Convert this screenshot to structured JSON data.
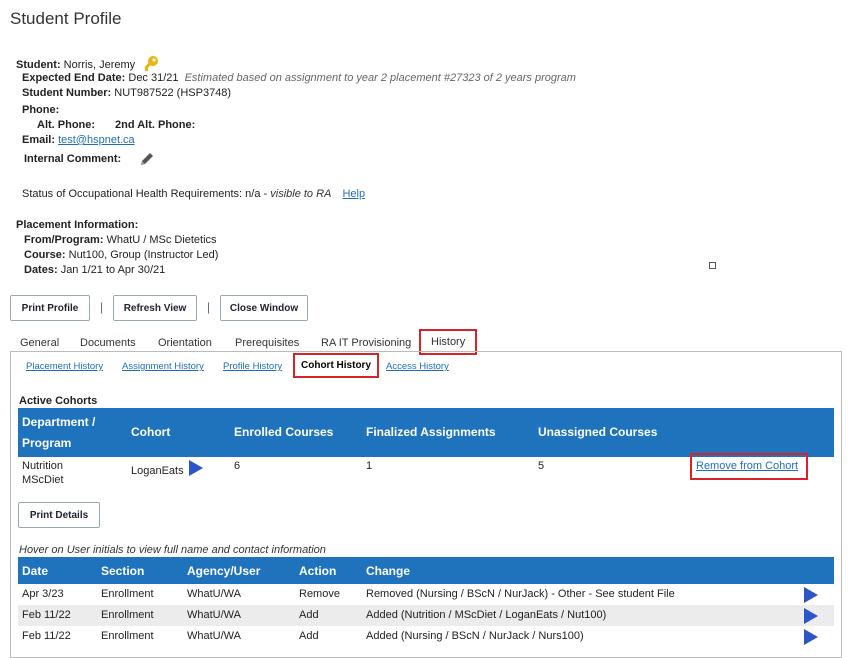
{
  "page_title": "Student Profile",
  "student": {
    "label": "Student:",
    "name": "Norris, Jeremy",
    "expected_end_label": "Expected End Date:",
    "expected_end": "Dec 31/21",
    "expected_end_note": "Estimated based on assignment to year 2 placement #27323 of 2 years program",
    "number_label": "Student Number:",
    "number": "NUT987522  (HSP3748)",
    "phone_label": "Phone:",
    "alt_phone_label": "Alt. Phone:",
    "alt2_phone_label": "2nd Alt. Phone:",
    "email_label": "Email:",
    "email": "test@hspnet.ca",
    "internal_comment_label": "Internal Comment:"
  },
  "health": {
    "text": "Status of Occupational Health Requirements: n/a -",
    "note": "visible to RA",
    "help": "Help"
  },
  "placement": {
    "heading": "Placement Information:",
    "from_label": "From/Program:",
    "from": "WhatU / MSc Dietetics",
    "course_label": "Course:",
    "course": "Nut100, Group (Instructor Led)",
    "dates_label": "Dates:",
    "dates": "Jan 1/21  to  Apr 30/21"
  },
  "buttons": {
    "print_profile": "Print Profile",
    "refresh_view": "Refresh View",
    "close_window": "Close Window",
    "sep": "|",
    "print_details": "Print Details"
  },
  "tabs": [
    "General",
    "Documents",
    "Orientation",
    "Prerequisites",
    "RA IT Provisioning",
    "History"
  ],
  "subtabs": [
    "Placement History",
    "Assignment History",
    "Profile History",
    "Cohort History",
    "Access History"
  ],
  "active_cohorts": {
    "heading": "Active Cohorts",
    "headers": [
      "Department /",
      "Program",
      "Cohort",
      "Enrolled Courses",
      "Finalized Assignments",
      "Unassigned Courses"
    ],
    "row": {
      "dept1": "Nutrition",
      "dept2": "MScDiet",
      "cohort": "LoganEats",
      "enrolled": "6",
      "finalized": "1",
      "unassigned": "5",
      "action": "Remove from Cohort"
    }
  },
  "history": {
    "hint": "Hover on User initials to view full name and contact information",
    "headers": [
      "Date",
      "Section",
      "Agency/User",
      "Action",
      "Change"
    ],
    "rows": [
      {
        "date": "Apr 3/23",
        "section": "Enrollment",
        "agency": "WhatU/WA",
        "action": "Remove",
        "change": "Removed (Nursing / BScN / NurJack) - Other - See student File"
      },
      {
        "date": "Feb 11/22",
        "section": "Enrollment",
        "agency": "WhatU/WA",
        "action": "Add",
        "change": "Added (Nutrition / MScDiet / LoganEats / Nut100)"
      },
      {
        "date": "Feb 11/22",
        "section": "Enrollment",
        "agency": "WhatU/WA",
        "action": "Add",
        "change": "Added (Nursing / BScN / NurJack / Nurs100)"
      }
    ]
  },
  "colors": {
    "accent": "#1f73bd",
    "highlight": "#d8232a",
    "link": "#1f6fb7",
    "play": "#2b55c9"
  }
}
